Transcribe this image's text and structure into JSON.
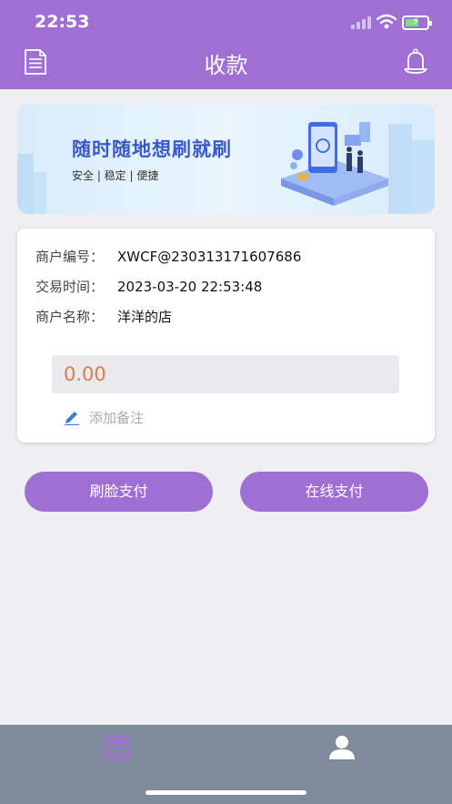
{
  "status_bar": {
    "time": "22:53"
  },
  "nav": {
    "title": "收款",
    "left_icon": "document-icon",
    "right_icon": "bell-icon"
  },
  "banner": {
    "title": "随时随地想刷就刷",
    "subtitle": "安全 | 稳定 | 便捷"
  },
  "merchant": {
    "id_label": "商户编号：",
    "id_value": "XWCF@230313171607686",
    "time_label": "交易时间：",
    "time_value": "2023-03-20 22:53:48",
    "name_label": "商户名称：",
    "name_value": "洋洋的店"
  },
  "amount": {
    "value": "0.00"
  },
  "note": {
    "placeholder": "添加备注",
    "icon": "pencil-icon"
  },
  "actions": {
    "face_pay": "刷脸支付",
    "online_pay": "在线支付"
  },
  "tabbar": {
    "items": [
      {
        "icon": "calculator-icon",
        "active": true
      },
      {
        "icon": "user-icon",
        "active": false
      }
    ]
  },
  "colors": {
    "primary": "#a06fd4",
    "amount": "#e07a4c",
    "tabbar": "#7f8a9b",
    "page_bg": "#efeff1"
  }
}
